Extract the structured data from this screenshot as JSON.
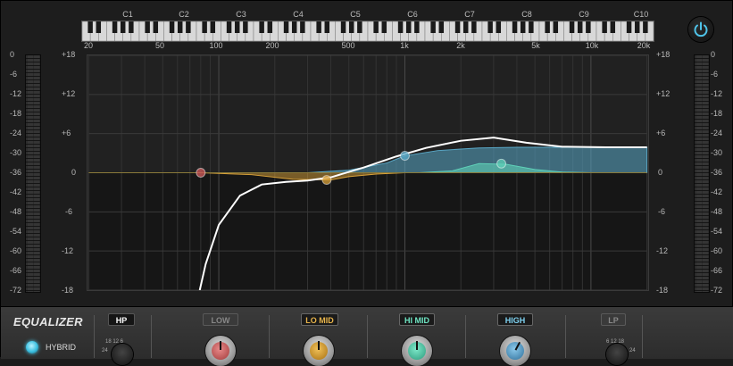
{
  "colors": {
    "accent_blue": "#5aa9c8",
    "accent_teal": "#5fd0b8",
    "accent_orange": "#d9a23a",
    "accent_red": "#d05a5a",
    "curve": "#ffffff"
  },
  "note_labels": [
    "C1",
    "C2",
    "C3",
    "C4",
    "C5",
    "C6",
    "C7",
    "C8",
    "C9",
    "C10"
  ],
  "freq_labels": [
    "20",
    "50",
    "100",
    "200",
    "500",
    "1k",
    "2k",
    "5k",
    "10k",
    "20k"
  ],
  "left_meter_scale": [
    "0",
    "-6",
    "-12",
    "-18",
    "-24",
    "-30",
    "-36",
    "-42",
    "-48",
    "-54",
    "-60",
    "-66",
    "-72"
  ],
  "right_meter_scale": [
    "0",
    "-6",
    "-12",
    "-18",
    "-24",
    "-30",
    "-36",
    "-42",
    "-48",
    "-54",
    "-60",
    "-66",
    "-72"
  ],
  "gain_scale": [
    "+18",
    "+12",
    "+6",
    "0",
    "-6",
    "-12",
    "-18"
  ],
  "icons": {
    "power": "power-icon"
  },
  "panel": {
    "title": "EQUALIZER",
    "hybrid_label": "HYBRID",
    "hp_label": "HP",
    "low_label": "LOW",
    "lomid_label": "LO MID",
    "himid_label": "HI MID",
    "high_label": "HIGH",
    "lp_label": "LP",
    "hp_ticks": "18 12 6",
    "hp_ticks2": "24",
    "lp_ticks": "6 12 18",
    "lp_ticks2": "24"
  },
  "chart_data": {
    "type": "line",
    "x_scale": "log",
    "xlim": [
      20,
      20000
    ],
    "ylim": [
      -18,
      18
    ],
    "grid": true,
    "series": [
      {
        "color": "#ffffff",
        "x": [
          79,
          85,
          100,
          130,
          170,
          230,
          300,
          400,
          600,
          900,
          1300,
          2000,
          3000,
          4500,
          7000,
          12000,
          20000
        ],
        "y": [
          -18,
          -14,
          -8,
          -3.5,
          -1.8,
          -1.4,
          -1.2,
          -0.7,
          0.8,
          2.5,
          3.8,
          4.9,
          5.4,
          4.6,
          4.0,
          3.9,
          3.9
        ]
      },
      {
        "color": "#5aa9c8",
        "x": [
          300,
          500,
          800,
          1000,
          1500,
          2500,
          4000,
          8000,
          20000
        ],
        "y": [
          0,
          0.4,
          1.5,
          2.6,
          3.4,
          3.8,
          3.9,
          3.9,
          3.9
        ]
      },
      {
        "color": "#5fd0b8",
        "x": [
          1200,
          1800,
          2500,
          3500,
          5000,
          7000,
          10000
        ],
        "y": [
          0,
          0.3,
          1.4,
          1.3,
          0.5,
          0.1,
          0
        ]
      },
      {
        "color": "#d9a23a",
        "x": [
          80,
          150,
          250,
          400,
          500,
          700,
          1000
        ],
        "y": [
          0,
          -0.3,
          -1.0,
          -1.1,
          -0.6,
          -0.2,
          0
        ]
      }
    ],
    "points": [
      {
        "name": "low",
        "x": 80,
        "y": 0,
        "color": "#d05a5a"
      },
      {
        "name": "lomid",
        "x": 380,
        "y": -1.1,
        "color": "#d9a23a"
      },
      {
        "name": "himid",
        "x": 1000,
        "y": 2.6,
        "color": "#5aa9c8"
      },
      {
        "name": "high",
        "x": 3300,
        "y": 1.4,
        "color": "#5fd0b8"
      }
    ]
  }
}
